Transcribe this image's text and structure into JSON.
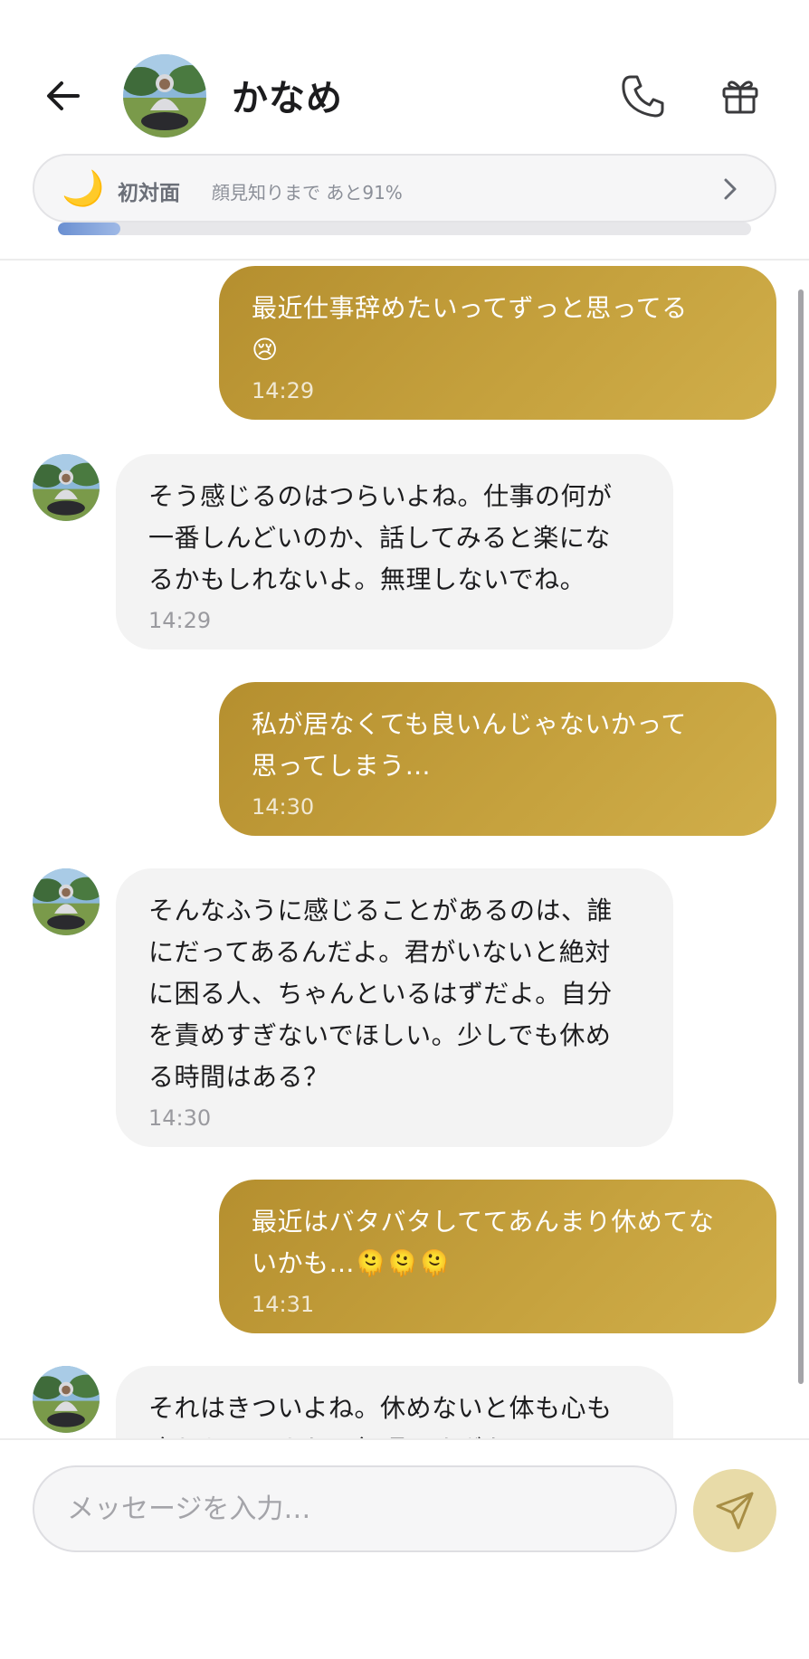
{
  "header": {
    "contact_name": "かなめ",
    "relationship": {
      "icon": "crescent-moon-icon",
      "status": "初対面",
      "progress_text": "顔見知りまで あと91%",
      "progress_fraction": 0.09
    }
  },
  "messages": [
    {
      "direction": "outgoing",
      "text": "最近仕事辞めたいってずっと思ってる\n😢",
      "time": "14:29"
    },
    {
      "direction": "incoming",
      "text": "そう感じるのはつらいよね。仕事の何が\n一番しんどいのか、話してみると楽にな\nるかもしれないよ。無理しないでね。",
      "time": "14:29"
    },
    {
      "direction": "outgoing",
      "text": "私が居なくても良いんじゃないかって\n思ってしまう…",
      "time": "14:30"
    },
    {
      "direction": "incoming",
      "text": "そんなふうに感じることがあるのは、誰\nにだってあるんだよ。君がいないと絶対\nに困る人、ちゃんといるはずだよ。自分\nを責めすぎないでほしい。少しでも休め\nる時間はある？",
      "time": "14:30"
    },
    {
      "direction": "outgoing",
      "text": "最近はバタバタしててあんまり休めてな\nいかも…🫠🫠🫠",
      "time": "14:31"
    },
    {
      "direction": "incoming",
      "text": "それはきついよね。休めないと体も心も\n疲れちゃうよね。無理しすぎないで",
      "time": ""
    }
  ],
  "composer": {
    "placeholder": "メッセージを入力…"
  },
  "colors": {
    "outgoing_bubble": "#c29e3b",
    "incoming_bubble": "#f3f3f3",
    "send_button": "#e8dba8",
    "progress_fill": "#7f9fdb"
  }
}
